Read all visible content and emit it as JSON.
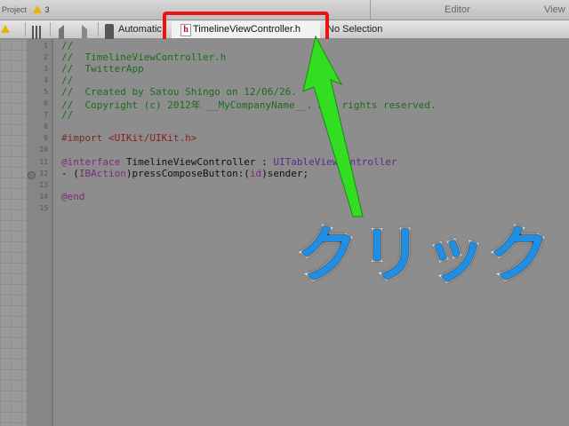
{
  "topbar": {
    "project_label": "Project",
    "warning_count": "3",
    "editor_label": "Editor",
    "view_label": "View"
  },
  "jumpbar": {
    "automatic_label": "Automatic",
    "file_label": "TimelineViewController.h",
    "no_selection_label": "No Selection"
  },
  "code": {
    "lines": [
      {
        "n": "1",
        "text": "//",
        "kind": "comment"
      },
      {
        "n": "2",
        "text": "//  TimelineViewController.h",
        "kind": "comment"
      },
      {
        "n": "3",
        "text": "//  TwitterApp",
        "kind": "comment"
      },
      {
        "n": "4",
        "text": "//",
        "kind": "comment"
      },
      {
        "n": "5",
        "text": "//  Created by Satou Shingo on 12/06/26.",
        "kind": "comment"
      },
      {
        "n": "6",
        "text": "//  Copyright (c) 2012年 __MyCompanyName__. All rights reserved.",
        "kind": "comment"
      },
      {
        "n": "7",
        "text": "//",
        "kind": "comment"
      },
      {
        "n": "8",
        "text": "",
        "kind": "plain"
      },
      {
        "n": "9",
        "text": "#import <UIKit/UIKit.h>",
        "kind": "import"
      },
      {
        "n": "10",
        "text": "",
        "kind": "plain"
      },
      {
        "n": "11",
        "text": "@interface TimelineViewController : UITableViewController",
        "kind": "interface"
      },
      {
        "n": "12",
        "text": "- (IBAction)pressComposeButton:(id)sender;",
        "kind": "method"
      },
      {
        "n": "13",
        "text": "",
        "kind": "plain"
      },
      {
        "n": "14",
        "text": "@end",
        "kind": "end"
      },
      {
        "n": "15",
        "text": "",
        "kind": "plain"
      }
    ]
  },
  "callout": {
    "text": "クリック"
  },
  "colors": {
    "highlight_border": "#ee1111",
    "arrow_green": "#33dd22",
    "callout_blue": "#1f8fe6"
  }
}
